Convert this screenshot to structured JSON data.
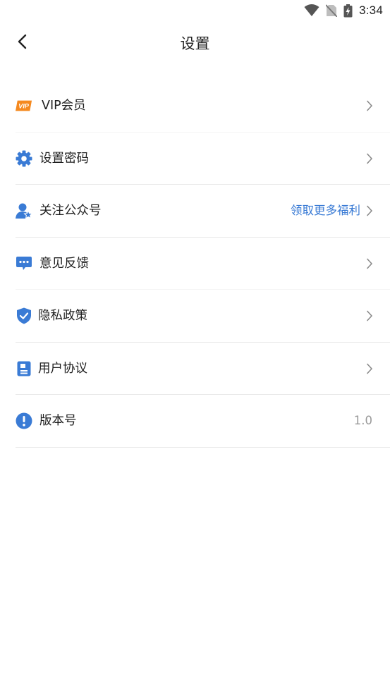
{
  "status_bar": {
    "time": "3:34",
    "icons": [
      "wifi-icon",
      "no-sim-icon",
      "battery-charging-icon"
    ]
  },
  "nav": {
    "back_icon": "chevron-left-icon",
    "title": "设置"
  },
  "settings": [
    {
      "id": "vip",
      "label": "VIP会员",
      "icon": "vip-badge-icon",
      "icon_text": "VIP",
      "chevron": true
    },
    {
      "id": "password",
      "label": "设置密码",
      "icon": "gear-icon",
      "chevron": true
    },
    {
      "id": "follow",
      "label": "关注公众号",
      "icon": "user-star-icon",
      "value": "领取更多福利",
      "chevron": true
    },
    {
      "id": "feedback",
      "label": "意见反馈",
      "icon": "chat-bubble-icon",
      "chevron": true
    },
    {
      "id": "privacy",
      "label": "隐私政策",
      "icon": "shield-check-icon",
      "chevron": true
    },
    {
      "id": "agreement",
      "label": "用户协议",
      "icon": "document-icon",
      "chevron": true
    },
    {
      "id": "version",
      "label": "版本号",
      "icon": "info-exclamation-icon",
      "value": "1.0",
      "chevron": false
    }
  ],
  "colors": {
    "accent_blue": "#3a7bd5",
    "vip_orange": "#f5891f",
    "divider": "#e8e8e8",
    "muted_text": "#9a9a9a"
  }
}
